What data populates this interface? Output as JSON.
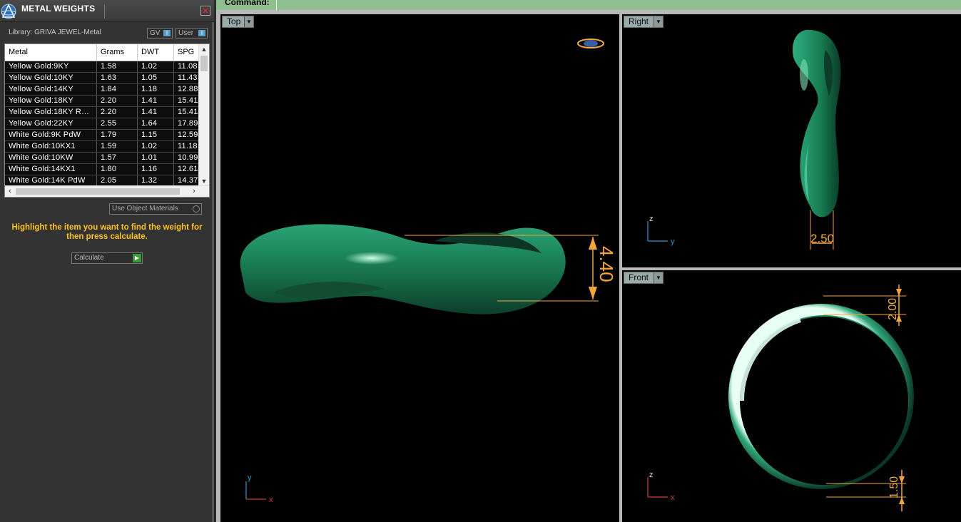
{
  "panel": {
    "title": "METAL WEIGHTS",
    "library_label": "Library: GRIVA JEWEL-Metal",
    "toggle_gv": "GV",
    "toggle_user": "User",
    "close_symbol": "✕",
    "use_object_materials": "Use Object Materials",
    "instruction": "Highlight the item you want to find the weight for then press calculate.",
    "calculate_button": "Calculate"
  },
  "table": {
    "headers": [
      "Metal",
      "Grams",
      "DWT",
      "SPG"
    ],
    "rows": [
      [
        "Yellow Gold:9KY",
        "1.58",
        "1.02",
        "11.08"
      ],
      [
        "Yellow Gold:10KY",
        "1.63",
        "1.05",
        "11.43"
      ],
      [
        "Yellow Gold:14KY",
        "1.84",
        "1.18",
        "12.88"
      ],
      [
        "Yellow Gold:18KY",
        "2.20",
        "1.41",
        "15.41"
      ],
      [
        "Yellow Gold:18KY R…",
        "2.20",
        "1.41",
        "15.41"
      ],
      [
        "Yellow Gold:22KY",
        "2.55",
        "1.64",
        "17.89"
      ],
      [
        "White Gold:9K PdW",
        "1.79",
        "1.15",
        "12.59"
      ],
      [
        "White Gold:10KX1",
        "1.59",
        "1.02",
        "11.18"
      ],
      [
        "White Gold:10KW",
        "1.57",
        "1.01",
        "10.99"
      ],
      [
        "White Gold:14KX1",
        "1.80",
        "1.16",
        "12.61"
      ],
      [
        "White Gold:14K PdW",
        "2.05",
        "1.32",
        "14.37"
      ]
    ]
  },
  "command": {
    "label": "Command:"
  },
  "viewports": {
    "top": {
      "label": "Top",
      "dimension": "4.40",
      "axis_y": "y",
      "axis_x": "x"
    },
    "right": {
      "label": "Right",
      "dimension": "2.50",
      "axis_z": "z",
      "axis_y": "y"
    },
    "front": {
      "label": "Front",
      "dimension_top": "2.00",
      "dimension_bottom": "1.50",
      "axis_z": "z",
      "axis_x": "x"
    }
  },
  "colors": {
    "ring": "#1f8a5e",
    "dimension": "#f3a73b",
    "panel_bg": "#333333",
    "command_bar": "#8fbf8f"
  },
  "icons": [
    "app-logo-icon",
    "close-icon",
    "dropdown-arrow-icon",
    "calculate-arrow-icon",
    "view-cube-icon"
  ]
}
